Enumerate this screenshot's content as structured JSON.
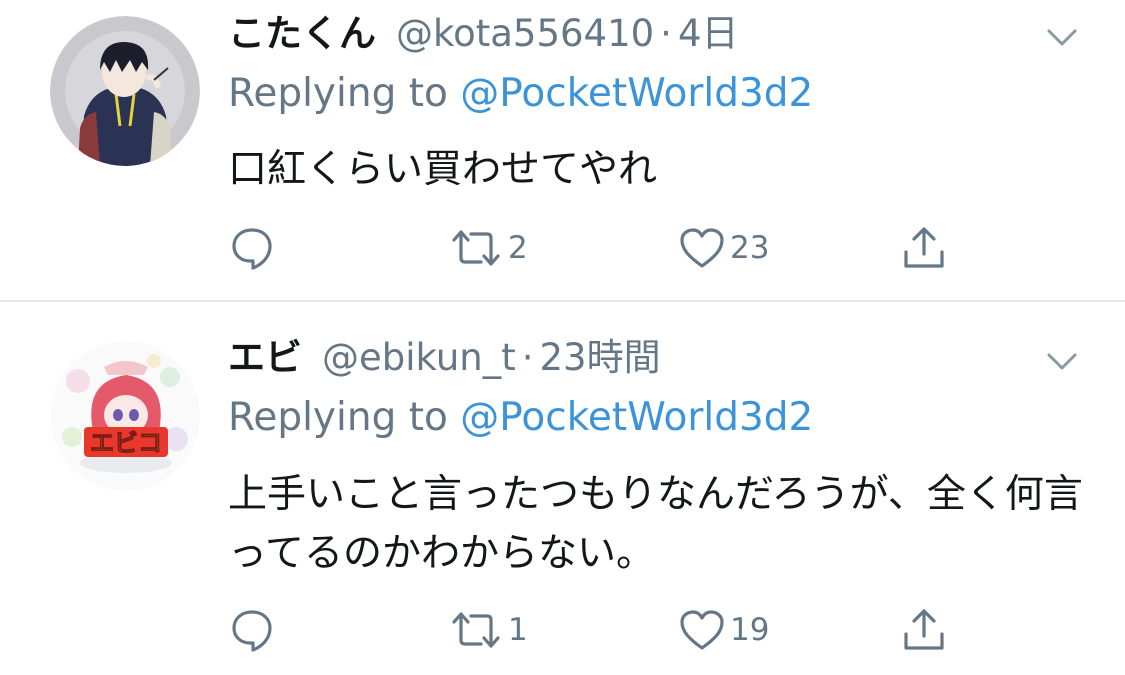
{
  "tweets": [
    {
      "display_name": "こたくん",
      "handle": "@kota556410",
      "separator": "·",
      "time": "4日",
      "replying_prefix": "Replying to ",
      "replying_mention": "@PocketWorld3d2",
      "text": "口紅くらい買わせてやれ",
      "retweets": "2",
      "likes": "23"
    },
    {
      "display_name": "エビ",
      "handle": "@ebikun_t",
      "separator": "·",
      "time": "23時間",
      "replying_prefix": "Replying to ",
      "replying_mention": "@PocketWorld3d2",
      "text": "上手いこと言ったつもりなんだろうが、全く何言ってるのかわからない。",
      "retweets": "1",
      "likes": "19",
      "avatar_logo_text": "エビコ"
    }
  ],
  "colors": {
    "text_primary": "#14171a",
    "text_secondary": "#657786",
    "link": "#3b94d9",
    "divider": "#e1e8ed",
    "icon": "#657786"
  },
  "icons": {
    "reply": "reply-icon",
    "retweet": "retweet-icon",
    "like": "heart-icon",
    "share": "share-icon",
    "menu": "chevron-down-icon"
  }
}
